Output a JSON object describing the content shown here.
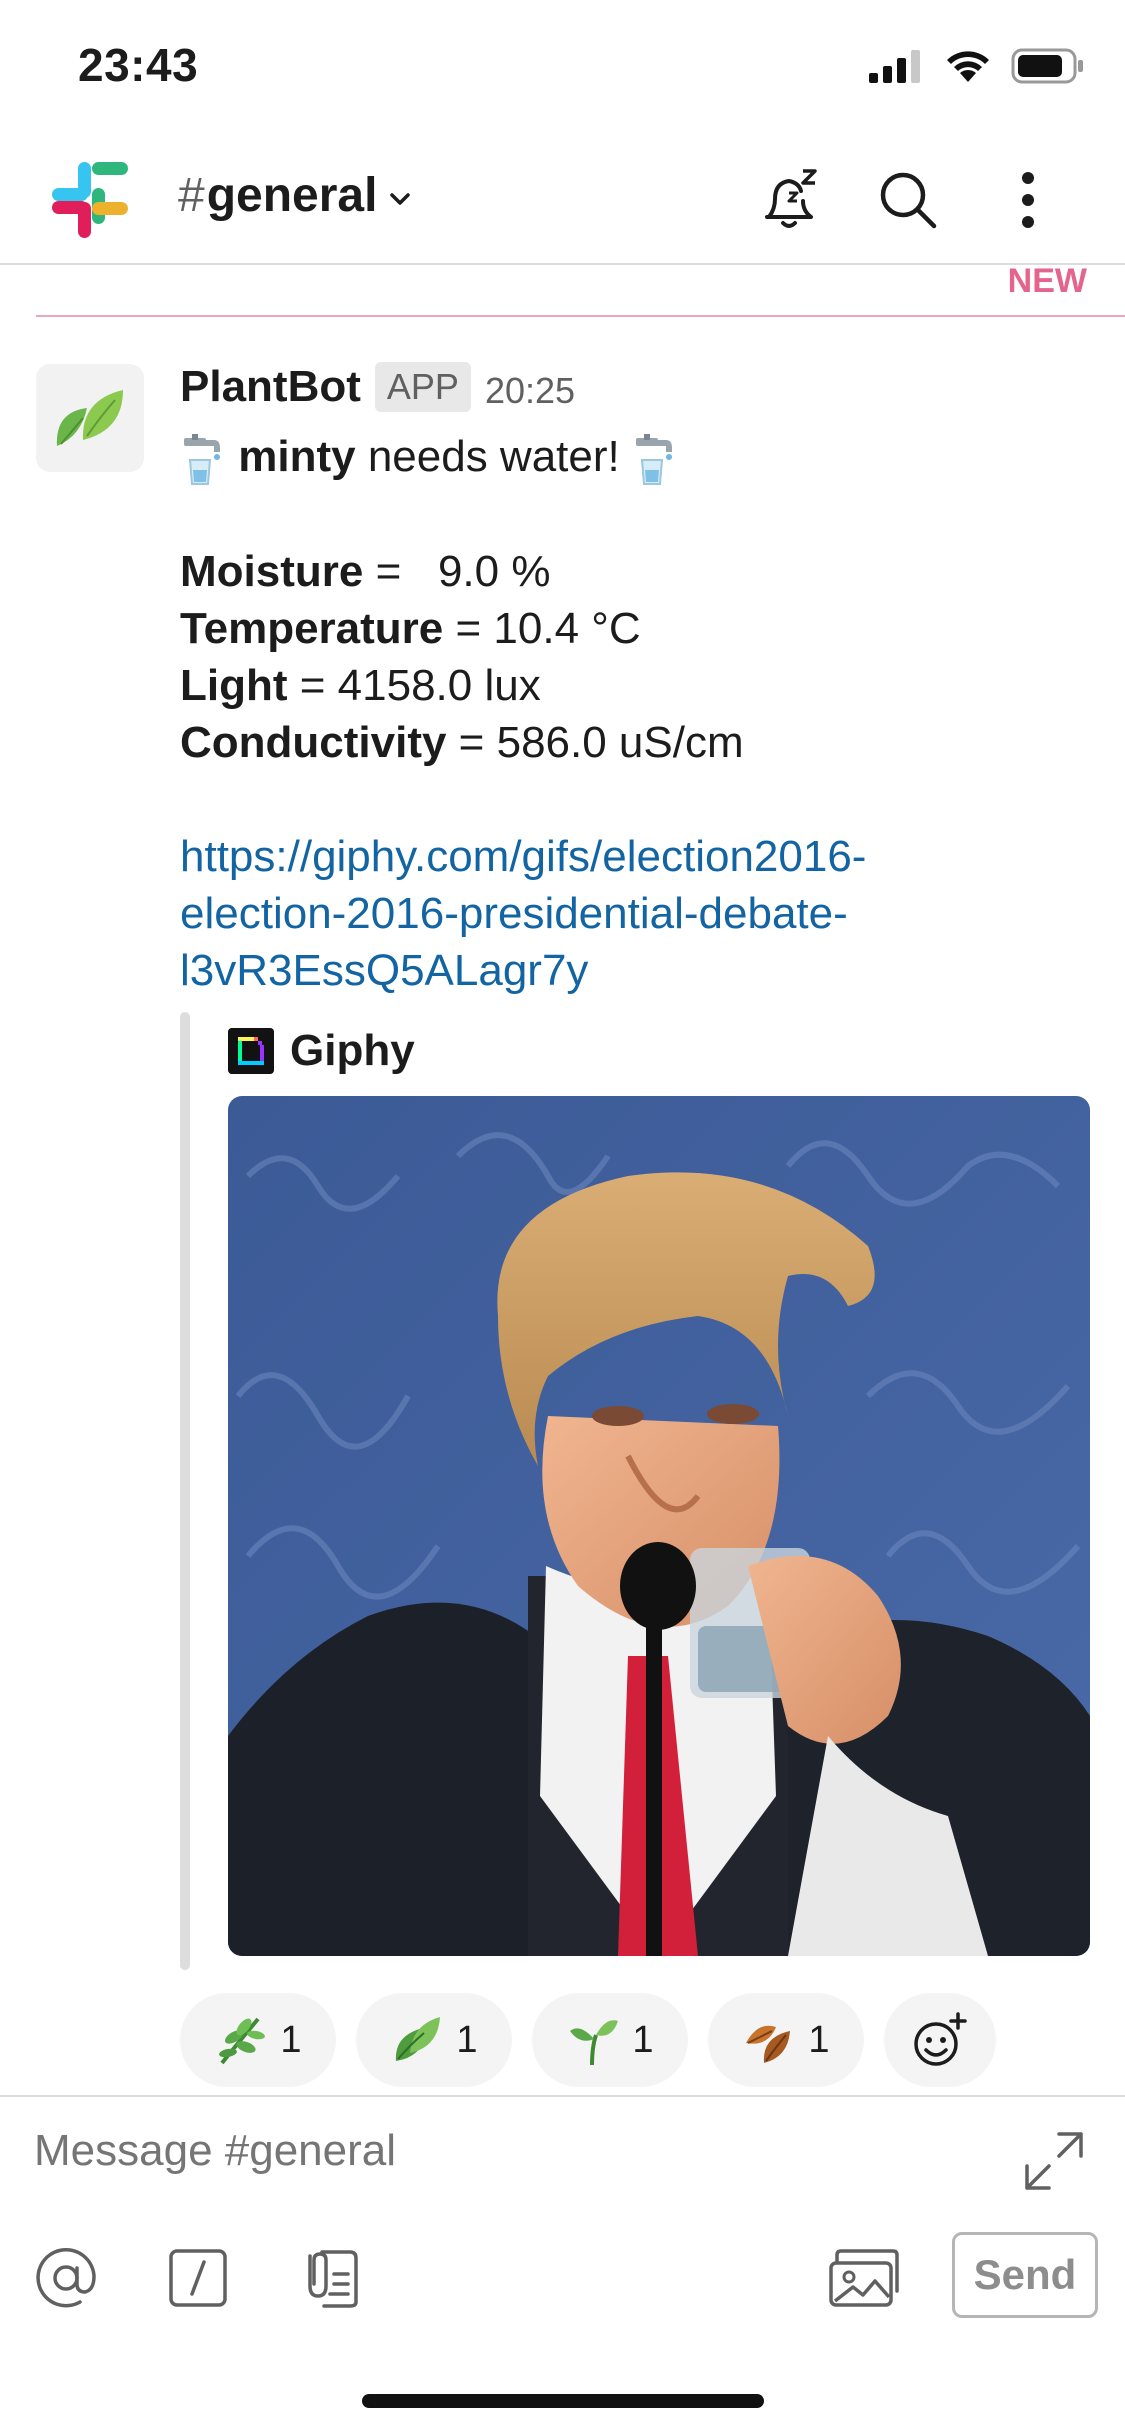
{
  "status_bar": {
    "time": "23:43"
  },
  "header": {
    "channel_hash": "#",
    "channel_name": "general"
  },
  "divider": {
    "new_label": "NEW"
  },
  "message": {
    "sender": "PlantBot",
    "badge": "APP",
    "timestamp": "20:25",
    "plant_name": "minty",
    "needs_text": " needs water! ",
    "readings": [
      {
        "label": "Moisture",
        "value": " =   9.0 %"
      },
      {
        "label": "Temperature",
        "value": " = 10.4 °C"
      },
      {
        "label": "Light",
        "value": " = 4158.0 lux"
      },
      {
        "label": "Conductivity",
        "value": " = 586.0 uS/cm"
      }
    ],
    "link_lines": [
      "https://giphy.com/gifs/election2016-",
      "election-2016-presidential-debate-",
      "l3vR3EssQ5ALagr7y"
    ]
  },
  "attachment": {
    "service": "Giphy"
  },
  "reactions": [
    {
      "icon": "herb-icon",
      "count": "1"
    },
    {
      "icon": "leaves-icon",
      "count": "1"
    },
    {
      "icon": "seedling-icon",
      "count": "1"
    },
    {
      "icon": "fallen-leaf-icon",
      "count": "1"
    }
  ],
  "composer": {
    "placeholder": "Message #general",
    "send_label": "Send"
  },
  "colors": {
    "link": "#1264a3",
    "new_divider": "#e0497a",
    "gif_background": "#3f5e99"
  }
}
